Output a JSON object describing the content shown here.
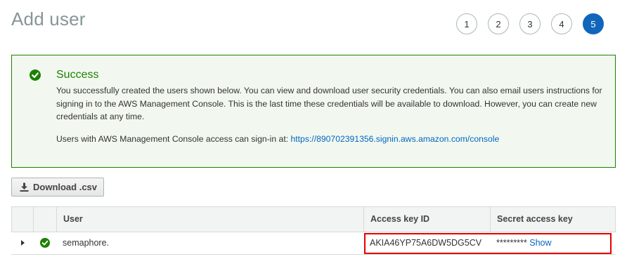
{
  "page": {
    "title": "Add user"
  },
  "steps": [
    "1",
    "2",
    "3",
    "4",
    "5"
  ],
  "active_step": "5",
  "success": {
    "title": "Success",
    "message": "You successfully created the users shown below. You can view and download user security credentials. You can also email users instructions for signing in to the AWS Management Console. This is the last time these credentials will be available to download. However, you can create new credentials at any time.",
    "signin_prefix": "Users with AWS Management Console access can sign-in at:",
    "signin_url": "https://890702391356.signin.aws.amazon.com/console"
  },
  "toolbar": {
    "download_label": "Download .csv",
    "download_icon": "download-icon"
  },
  "table": {
    "columns": [
      "User",
      "Access key ID",
      "Secret access key"
    ],
    "rows": [
      {
        "user": "semaphore.",
        "access_key_id": "AKIA46YP75A6DW5DG5CV",
        "secret_masked": "*********",
        "secret_action": "Show",
        "status_icon": "check-circle-icon"
      }
    ]
  },
  "colors": {
    "success_green": "#1d8102",
    "success_bg": "#f2f8f0",
    "step_active": "#1166bb",
    "link_blue": "#0066c0",
    "highlight_red": "#e50000"
  }
}
